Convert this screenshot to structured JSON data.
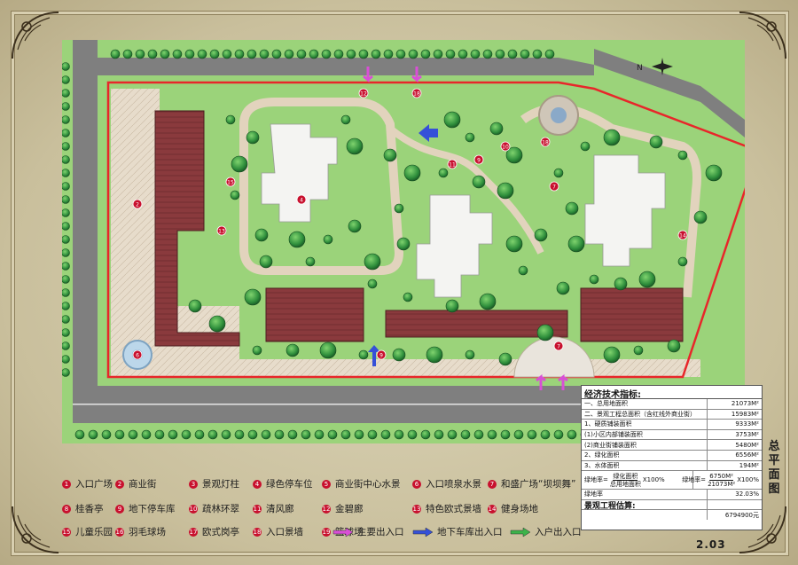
{
  "legend": {
    "items": [
      {
        "n": "1",
        "label": "入口广场"
      },
      {
        "n": "2",
        "label": "商业街"
      },
      {
        "n": "3",
        "label": "景观灯柱"
      },
      {
        "n": "4",
        "label": "绿色停车位"
      },
      {
        "n": "5",
        "label": "商业街中心水景"
      },
      {
        "n": "6",
        "label": "入口喷泉水景"
      },
      {
        "n": "7",
        "label": "和盛广场“坝坝舞”"
      },
      {
        "n": "8",
        "label": "桂香亭"
      },
      {
        "n": "9",
        "label": "地下停车库"
      },
      {
        "n": "10",
        "label": "疏林环翠"
      },
      {
        "n": "11",
        "label": "清风廊"
      },
      {
        "n": "12",
        "label": "金碧廊"
      },
      {
        "n": "13",
        "label": "特色欧式景墙"
      },
      {
        "n": "14",
        "label": "健身场地"
      },
      {
        "n": "15",
        "label": "儿童乐园"
      },
      {
        "n": "16",
        "label": "羽毛球场"
      },
      {
        "n": "17",
        "label": "欧式岗亭"
      },
      {
        "n": "18",
        "label": "入口景墙"
      },
      {
        "n": "19",
        "label": "篮球场"
      }
    ],
    "arrows": [
      {
        "label": "主要出入口",
        "color": "#d94fd6"
      },
      {
        "label": "地下车库出入口",
        "color": "#3550d8"
      },
      {
        "label": "入户出入口",
        "color": "#3cb34a"
      }
    ]
  },
  "tech": {
    "title": "经济技术指标:",
    "rows": [
      {
        "k": "一、总用地面积",
        "v": "21073M²"
      },
      {
        "k": "二、景观工程总面积（含红线外商业街）",
        "v": "15983M²"
      },
      {
        "k": "1、硬质铺装面积",
        "v": "9333M²"
      },
      {
        "k": "(1)小区内部铺装面积",
        "v": "3753M²"
      },
      {
        "k": "(2)商业街铺装面积",
        "v": "5480M²"
      },
      {
        "k": "2、绿化面积",
        "v": "6556M²"
      },
      {
        "k": "3、水体面积",
        "v": "194M²"
      }
    ],
    "formula": {
      "left_top": "绿化面积",
      "left_bottom": "总用地面积",
      "left_suffix": "X100%",
      "right_prefix": "绿地率=",
      "right_top": "6750M²",
      "right_bottom": "21073M²",
      "right_suffix": "X100%",
      "label": "绿地率="
    },
    "green_rate_label": "绿地率",
    "green_rate": "32.03%",
    "estimate_label": "景观工程估算:",
    "estimate_value": "6794900元"
  },
  "side_title": "总平面图",
  "page_number": "2.03",
  "compass": "N",
  "colors": {
    "red_line": "#e8262a",
    "roof": "#8a3a3d",
    "lawn": "#9bd37a",
    "tree": "#2f8f3c",
    "building": "#f4f4f2",
    "road": "#7f7f7f"
  }
}
